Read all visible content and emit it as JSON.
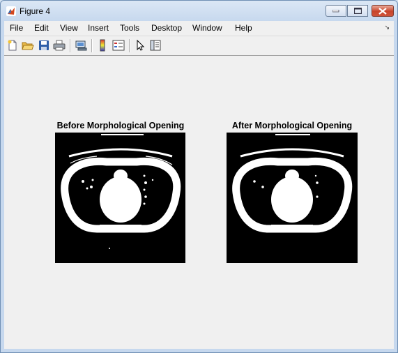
{
  "window": {
    "title": "Figure 4",
    "icon": "matlab-icon"
  },
  "menu": [
    "File",
    "Edit",
    "View",
    "Insert",
    "Tools",
    "Desktop",
    "Window",
    "Help"
  ],
  "toolbar": [
    "new-figure-icon",
    "open-file-icon",
    "save-icon",
    "print-icon",
    "link-plot-icon",
    "colorbar-icon",
    "legend-icon",
    "edit-plot-arrow-icon",
    "property-inspector-icon"
  ],
  "plots": [
    {
      "title": "Before Morphological Opening",
      "image": "binary CT slice, chest cross-section (before opening)"
    },
    {
      "title": "After Morphological Opening",
      "image": "binary CT slice, chest cross-section (after opening)"
    }
  ]
}
